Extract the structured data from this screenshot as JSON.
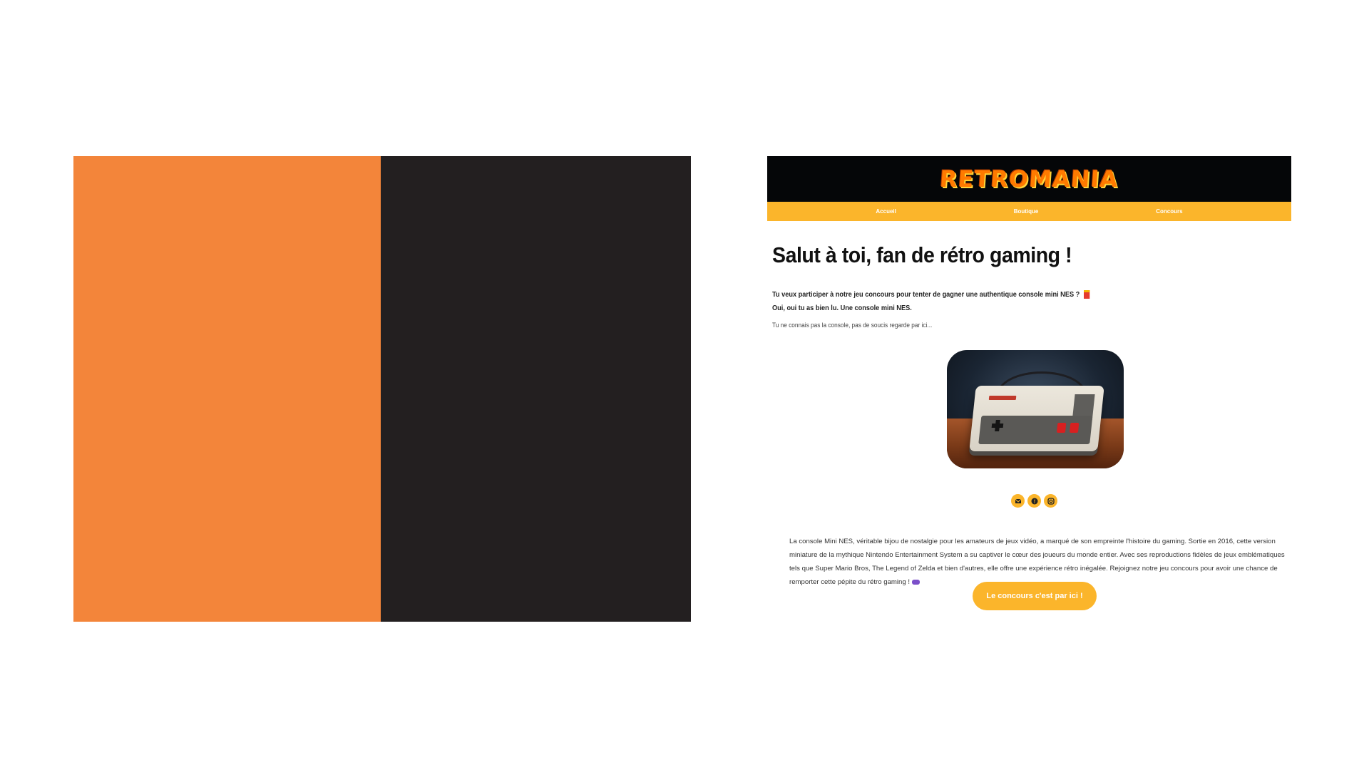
{
  "colors": {
    "orange_panel": "#F3853A",
    "dark_panel": "#231F20",
    "header_bg": "#050608",
    "nav_bg": "#FBB52B",
    "accent": "#FBB52B"
  },
  "header": {
    "logo_text": "RETROMANIA"
  },
  "nav": {
    "items": [
      {
        "label": "Accueil"
      },
      {
        "label": "Boutique"
      },
      {
        "label": "Concours"
      }
    ]
  },
  "main": {
    "title": "Salut à toi, fan de rétro gaming !",
    "intro_line1": "Tu veux participer à notre jeu concours pour tenter de gagner une authentique console mini NES ?",
    "intro_line2": "Oui, oui tu as bien lu. Une console mini NES.",
    "small_note": "Tu ne connais pas la console, pas de soucis regarde par ici...",
    "description": "La console Mini NES, véritable bijou de nostalgie pour les amateurs de jeux vidéo, a marqué de son empreinte l'histoire du gaming. Sortie en 2016, cette version miniature de la mythique Nintendo Entertainment System a su captiver le cœur des joueurs du monde entier. Avec ses reproductions fidèles de jeux emblématiques tels que Super Mario Bros, The Legend of Zelda et bien d'autres, elle offre une expérience rétro inégalée. Rejoignez notre jeu concours pour avoir une chance de remporter cette pépite du rétro gaming !",
    "cta_label": "Le concours c'est par ici !"
  },
  "icons": {
    "intro_icon": "gift-icon",
    "social": [
      "email-icon",
      "facebook-icon",
      "instagram-icon"
    ],
    "description_icon": "gamepad-icon"
  }
}
